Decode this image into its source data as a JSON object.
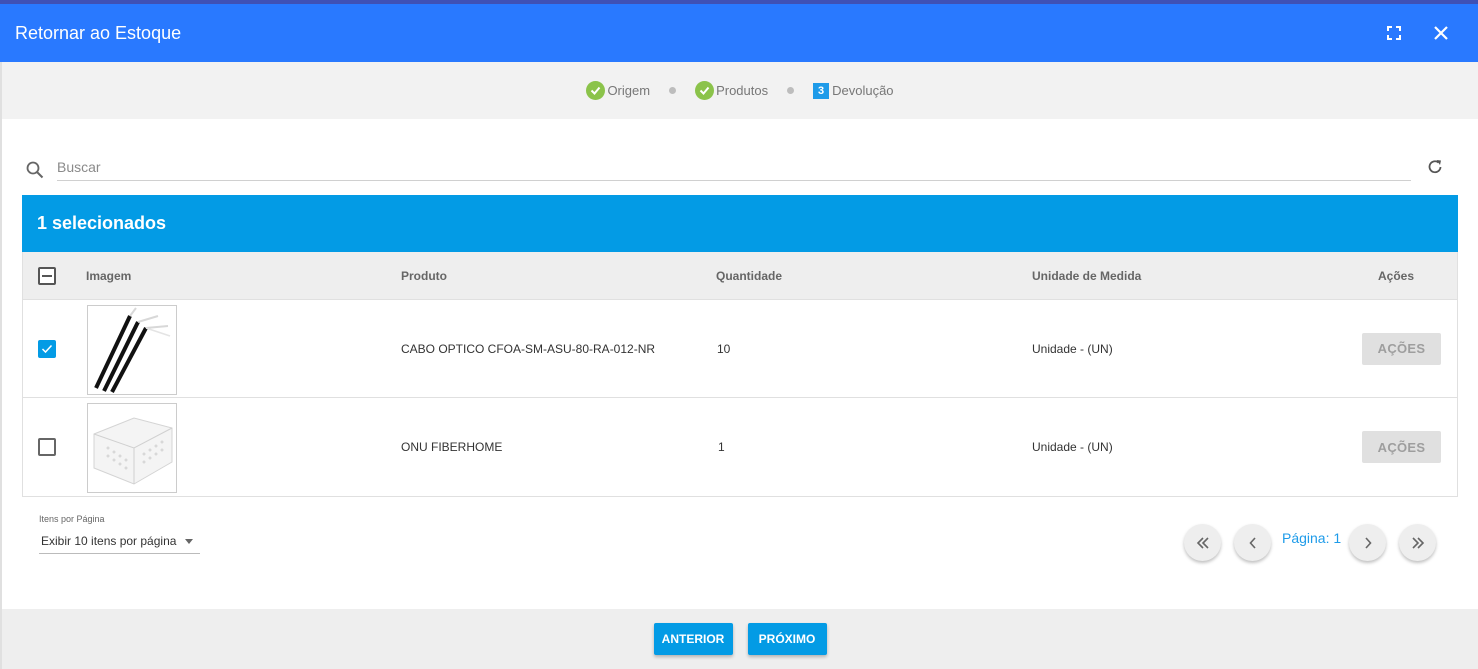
{
  "dialog": {
    "title": "Retornar ao Estoque"
  },
  "stepper": {
    "steps": [
      {
        "label": "Origem",
        "state": "done"
      },
      {
        "label": "Produtos",
        "state": "done"
      },
      {
        "label": "Devolução",
        "state": "active",
        "number": "3"
      }
    ]
  },
  "search": {
    "placeholder": "Buscar",
    "value": ""
  },
  "selection": {
    "text": "1 selecionados"
  },
  "table": {
    "columns": [
      "Imagem",
      "Produto",
      "Quantidade",
      "Unidade de Medida",
      "Ações"
    ],
    "rows": [
      {
        "selected": true,
        "image": "fiber-optic-cable-image",
        "produto": "CABO OPTICO CFOA-SM-ASU-80-RA-012-NR",
        "quantidade": "10",
        "unidade": "Unidade - (UN)",
        "acoes": "AÇÕES"
      },
      {
        "selected": false,
        "image": "onu-device-image",
        "produto": "ONU FIBERHOME",
        "quantidade": "1",
        "unidade": "Unidade - (UN)",
        "acoes": "AÇÕES"
      }
    ]
  },
  "pagination": {
    "per_page_label": "Itens por Página",
    "per_page_value": "Exibir 10 itens por página",
    "page_text": "Página: 1"
  },
  "footer": {
    "prev_label": "ANTERIOR",
    "next_label": "PRÓXIMO"
  },
  "colors": {
    "header": "#2979ff",
    "selection_bar": "#039be5",
    "step_done": "#8bc34a",
    "accent": "#1e9be9"
  },
  "icons": {
    "fullscreen": "fullscreen-icon",
    "close": "close-icon",
    "search": "search-icon",
    "refresh": "refresh-icon",
    "first": "double-chevron-left-icon",
    "prev": "chevron-left-icon",
    "next": "chevron-right-icon",
    "last": "double-chevron-right-icon"
  }
}
